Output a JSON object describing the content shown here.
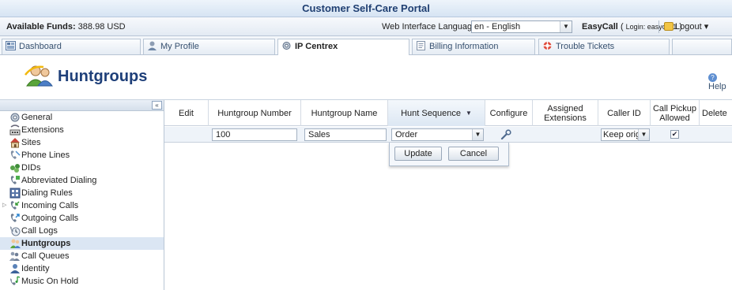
{
  "window": {
    "title": "Customer Self-Care Portal"
  },
  "info": {
    "funds_label": "Available Funds:",
    "funds_value": "388.98 USD",
    "language_label": "Web Interface Language:",
    "language_value": "en - English",
    "account_name": "EasyCall",
    "login_text": "Login: easycall1",
    "logout_label": "Logout"
  },
  "tabs": [
    {
      "label": "Dashboard"
    },
    {
      "label": "My Profile"
    },
    {
      "label": "IP Centrex",
      "active": true
    },
    {
      "label": "Billing Information"
    },
    {
      "label": "Trouble Tickets"
    }
  ],
  "page": {
    "title": "Huntgroups",
    "help_label": "Help"
  },
  "sidebar": {
    "collapse_label": "«",
    "items": [
      {
        "label": "General",
        "icon": "gear-icon"
      },
      {
        "label": "Extensions",
        "icon": "extensions-icon"
      },
      {
        "label": "Sites",
        "icon": "sites-icon"
      },
      {
        "label": "Phone Lines",
        "icon": "phone-lines-icon"
      },
      {
        "label": "DIDs",
        "icon": "dids-icon"
      },
      {
        "label": "Abbreviated Dialing",
        "icon": "abbreviated-dialing-icon"
      },
      {
        "label": "Dialing Rules",
        "icon": "dialing-rules-icon"
      },
      {
        "label": "Incoming Calls",
        "icon": "incoming-calls-icon",
        "expandable": true
      },
      {
        "label": "Outgoing Calls",
        "icon": "outgoing-calls-icon"
      },
      {
        "label": "Call Logs",
        "icon": "call-logs-icon"
      },
      {
        "label": "Huntgroups",
        "icon": "huntgroups-icon",
        "active": true
      },
      {
        "label": "Call Queues",
        "icon": "call-queues-icon"
      },
      {
        "label": "Identity",
        "icon": "identity-icon"
      },
      {
        "label": "Music On Hold",
        "icon": "music-on-hold-icon"
      }
    ]
  },
  "table": {
    "columns": [
      "Edit",
      "Huntgroup Number",
      "Huntgroup Name",
      "Hunt Sequence",
      "Configure",
      "Assigned Extensions",
      "Caller ID",
      "Call Pickup Allowed",
      "Delete"
    ],
    "sorted_column": "Hunt Sequence",
    "edit_row": {
      "number": "100",
      "name": "Sales",
      "sequence": "Order",
      "caller_id": "Keep origi",
      "pickup_allowed": true
    },
    "update_label": "Update",
    "cancel_label": "Cancel"
  },
  "colors": {
    "title_text": "#1e3f79",
    "active_nav": "#dbe6f3",
    "edit_row": "#eef3f9"
  }
}
